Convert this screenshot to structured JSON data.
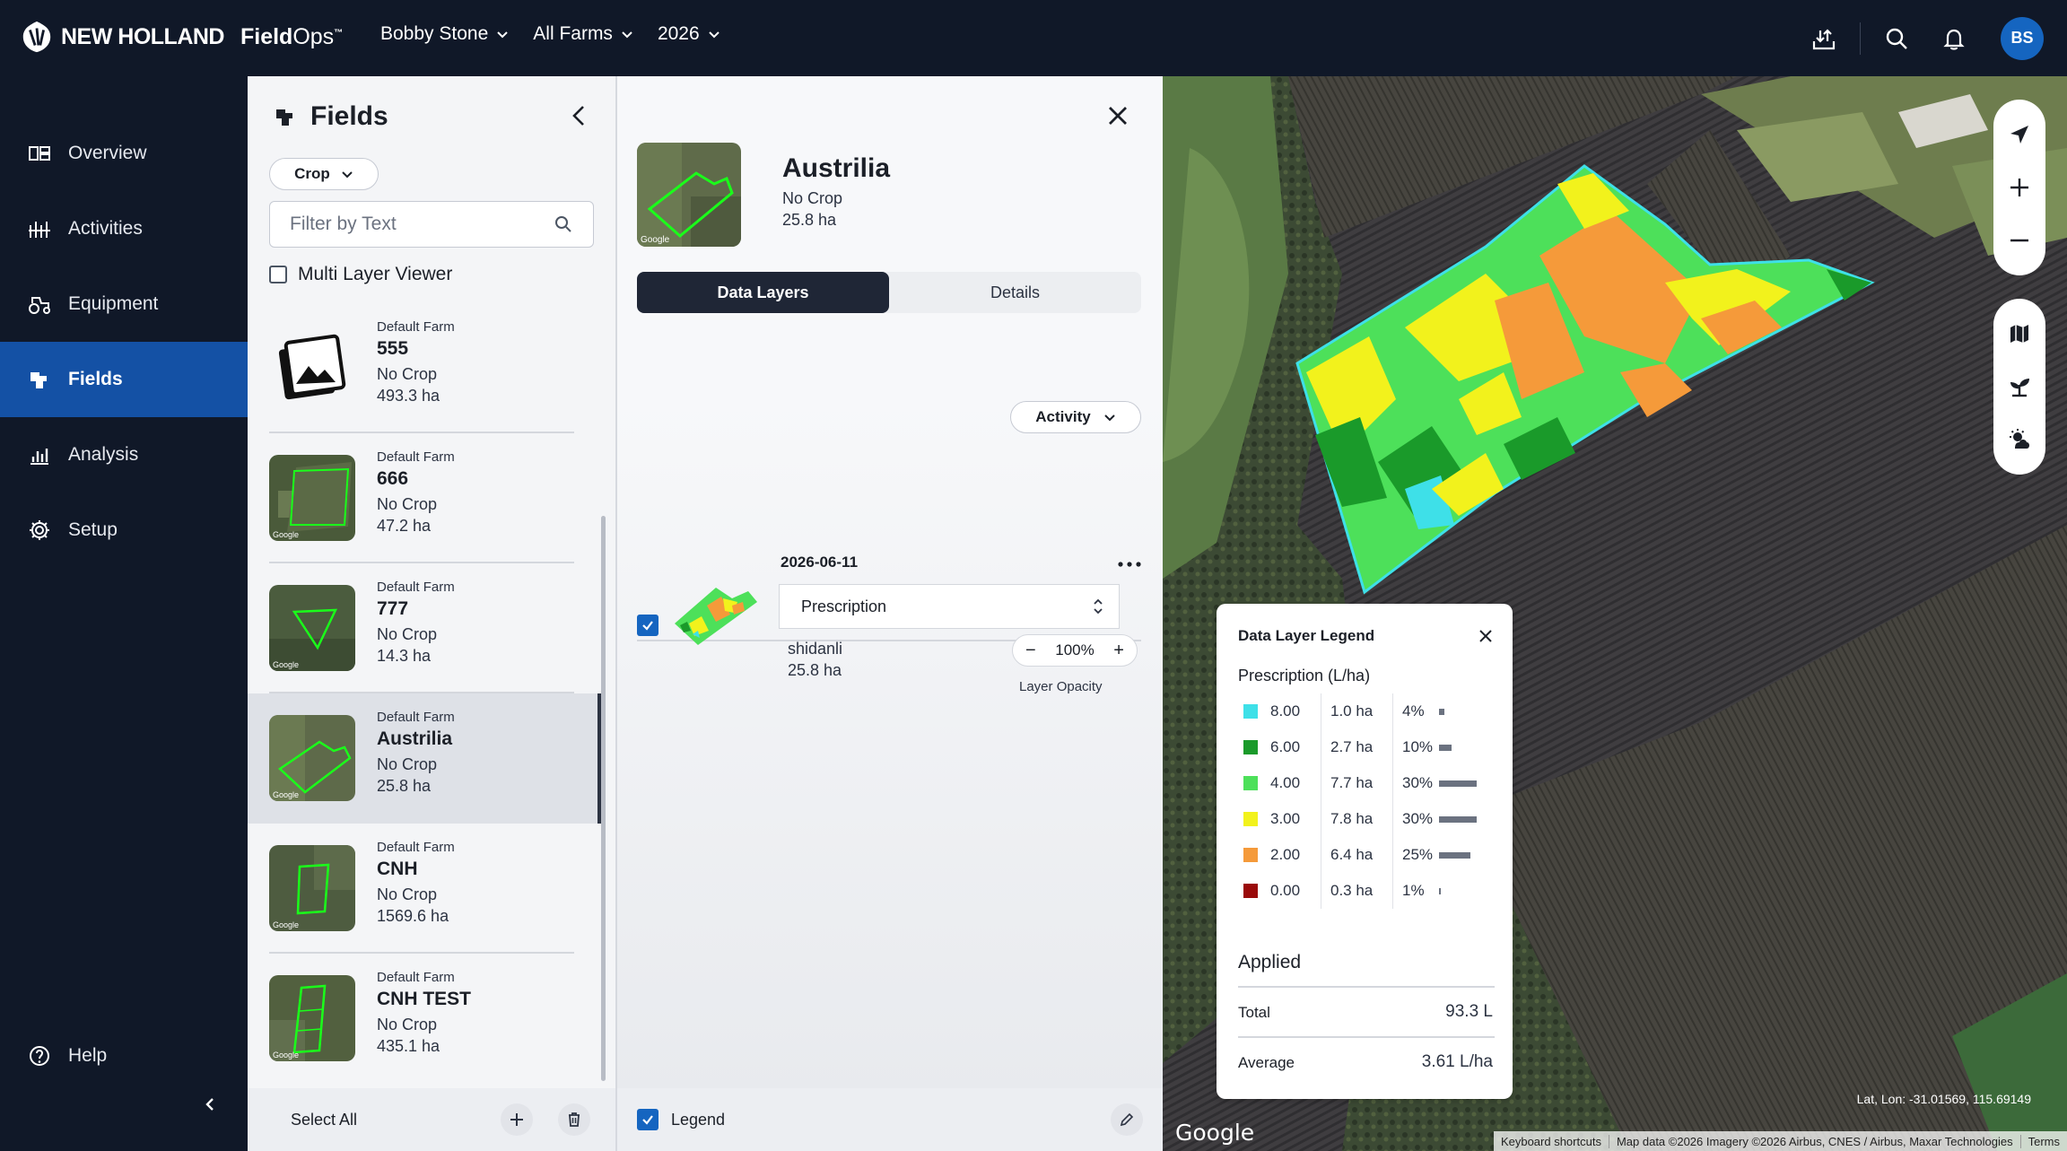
{
  "brand": {
    "name": "NEW HOLLAND",
    "product_bold": "Field",
    "product_light": "Ops",
    "tm": "™"
  },
  "topnav": {
    "user": "Bobby Stone",
    "farm": "All Farms",
    "year": "2026"
  },
  "avatar": "BS",
  "sidebar": {
    "items": [
      {
        "label": "Overview",
        "icon": "overview-icon"
      },
      {
        "label": "Activities",
        "icon": "activities-icon"
      },
      {
        "label": "Equipment",
        "icon": "tractor-icon"
      },
      {
        "label": "Fields",
        "icon": "fields-icon",
        "active": true
      },
      {
        "label": "Analysis",
        "icon": "chart-icon"
      },
      {
        "label": "Setup",
        "icon": "gear-icon"
      }
    ],
    "help": "Help"
  },
  "fields_panel": {
    "title": "Fields",
    "crop_filter": "Crop",
    "filter_placeholder": "Filter by Text",
    "multi_layer": "Multi Layer Viewer",
    "items": [
      {
        "farm": "Default Farm",
        "name": "555",
        "crop": "No Crop",
        "area": "493.3 ha"
      },
      {
        "farm": "Default Farm",
        "name": "666",
        "crop": "No Crop",
        "area": "47.2 ha"
      },
      {
        "farm": "Default Farm",
        "name": "777",
        "crop": "No Crop",
        "area": "14.3 ha"
      },
      {
        "farm": "Default Farm",
        "name": "Austrilia",
        "crop": "No Crop",
        "area": "25.8 ha",
        "selected": true
      },
      {
        "farm": "Default Farm",
        "name": "CNH",
        "crop": "No Crop",
        "area": "1569.6 ha"
      },
      {
        "farm": "Default Farm",
        "name": "CNH TEST",
        "crop": "No Crop",
        "area": "435.1 ha"
      }
    ],
    "select_all": "Select All"
  },
  "detail": {
    "title": "Austrilia",
    "crop": "No Crop",
    "area": "25.8 ha",
    "tabs": [
      "Data Layers",
      "Details"
    ],
    "activity_btn": "Activity",
    "layer": {
      "date": "2026-06-11",
      "type": "Prescription",
      "operator": "shidanli",
      "area": "25.8 ha",
      "opacity": "100%",
      "opacity_label": "Layer Opacity"
    },
    "legend_label": "Legend"
  },
  "map": {
    "legend": {
      "title": "Data Layer Legend",
      "subtitle": "Prescription (L/ha)",
      "rows": [
        {
          "value": "8.00",
          "area": "1.0 ha",
          "pct": "4%",
          "fraction": 0.04,
          "color": "#3ee0e8"
        },
        {
          "value": "6.00",
          "area": "2.7 ha",
          "pct": "10%",
          "fraction": 0.1,
          "color": "#1a9a2a"
        },
        {
          "value": "4.00",
          "area": "7.7 ha",
          "pct": "30%",
          "fraction": 0.3,
          "color": "#4de05a"
        },
        {
          "value": "3.00",
          "area": "7.8 ha",
          "pct": "30%",
          "fraction": 0.3,
          "color": "#f2f21c"
        },
        {
          "value": "2.00",
          "area": "6.4 ha",
          "pct": "25%",
          "fraction": 0.25,
          "color": "#f59a3a"
        },
        {
          "value": "0.00",
          "area": "0.3 ha",
          "pct": "1%",
          "fraction": 0.01,
          "color": "#9a0a0a"
        }
      ],
      "applied": "Applied",
      "total_label": "Total",
      "total_value": "93.3 L",
      "avg_label": "Average",
      "avg_value": "3.61 L/ha"
    },
    "latlon": "Lat, Lon: -31.01569, 115.69149",
    "google": "Google",
    "attrib": [
      "Keyboard shortcuts",
      "Map data ©2026 Imagery ©2026 Airbus, CNES / Airbus, Maxar Technologies",
      "Terms"
    ]
  }
}
